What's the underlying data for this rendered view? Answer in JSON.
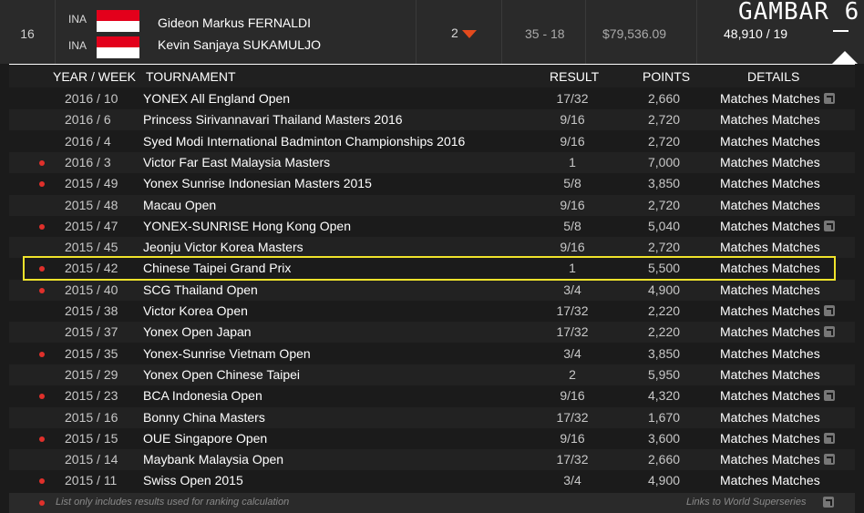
{
  "header": {
    "rank": "16",
    "players": [
      {
        "country": "INA",
        "name": "Gideon Markus FERNALDI"
      },
      {
        "country": "INA",
        "name": "Kevin Sanjaya SUKAMULJO"
      }
    ],
    "movement": "2",
    "win_loss": "35 - 18",
    "prize_money": "$79,536.09",
    "points_tournaments": "48,910 / 19",
    "overlay_label": "GAMBAR 6"
  },
  "columns": {
    "year_week": "YEAR / WEEK",
    "tournament": "TOURNAMENT",
    "result": "RESULT",
    "points": "POINTS",
    "details": "DETAILS"
  },
  "rows": [
    {
      "yw": "2016 / 10",
      "tn": "YONEX All England Open",
      "rs": "17/32",
      "pt": "2,660",
      "dt": "Matches Matches"
    },
    {
      "yw": "2016 / 6",
      "tn": "Princess Sirivannavari Thailand Masters 2016",
      "rs": "9/16",
      "pt": "2,720",
      "dt": "Matches Matches"
    },
    {
      "yw": "2016 / 4",
      "tn": "Syed Modi International Badminton Championships 2016",
      "rs": "9/16",
      "pt": "2,720",
      "dt": "Matches Matches"
    },
    {
      "yw": "2016 / 3",
      "tn": "Victor Far East Malaysia Masters",
      "rs": "1",
      "pt": "7,000",
      "dt": "Matches Matches"
    },
    {
      "yw": "2015 / 49",
      "tn": "Yonex Sunrise Indonesian Masters 2015",
      "rs": "5/8",
      "pt": "3,850",
      "dt": "Matches Matches"
    },
    {
      "yw": "2015 / 48",
      "tn": "Macau Open",
      "rs": "9/16",
      "pt": "2,720",
      "dt": "Matches Matches"
    },
    {
      "yw": "2015 / 47",
      "tn": "YONEX-SUNRISE Hong Kong Open",
      "rs": "5/8",
      "pt": "5,040",
      "dt": "Matches Matches"
    },
    {
      "yw": "2015 / 45",
      "tn": "Jeonju Victor Korea Masters",
      "rs": "9/16",
      "pt": "2,720",
      "dt": "Matches Matches"
    },
    {
      "yw": "2015 / 42",
      "tn": "Chinese Taipei Grand Prix",
      "rs": "1",
      "pt": "5,500",
      "dt": "Matches Matches"
    },
    {
      "yw": "2015 / 40",
      "tn": "SCG Thailand Open",
      "rs": "3/4",
      "pt": "4,900",
      "dt": "Matches Matches"
    },
    {
      "yw": "2015 / 38",
      "tn": "Victor Korea Open",
      "rs": "17/32",
      "pt": "2,220",
      "dt": "Matches Matches"
    },
    {
      "yw": "2015 / 37",
      "tn": "Yonex Open Japan",
      "rs": "17/32",
      "pt": "2,220",
      "dt": "Matches Matches"
    },
    {
      "yw": "2015 / 35",
      "tn": "Yonex-Sunrise Vietnam Open",
      "rs": "3/4",
      "pt": "3,850",
      "dt": "Matches Matches"
    },
    {
      "yw": "2015 / 29",
      "tn": "Yonex Open Chinese Taipei",
      "rs": "2",
      "pt": "5,950",
      "dt": "Matches Matches"
    },
    {
      "yw": "2015 / 23",
      "tn": "BCA Indonesia Open",
      "rs": "9/16",
      "pt": "4,320",
      "dt": "Matches Matches"
    },
    {
      "yw": "2015 / 16",
      "tn": "Bonny China Masters",
      "rs": "17/32",
      "pt": "1,670",
      "dt": "Matches Matches"
    },
    {
      "yw": "2015 / 15",
      "tn": "OUE Singapore Open",
      "rs": "9/16",
      "pt": "3,600",
      "dt": "Matches Matches"
    },
    {
      "yw": "2015 / 14",
      "tn": "Maybank Malaysia Open",
      "rs": "17/32",
      "pt": "2,660",
      "dt": "Matches Matches"
    },
    {
      "yw": "2015 / 11",
      "tn": "Swiss Open 2015",
      "rs": "3/4",
      "pt": "4,900",
      "dt": "Matches Matches"
    }
  ],
  "footer": {
    "note": "List only includes results used for ranking calculation",
    "link": "Links to World Superseries"
  }
}
